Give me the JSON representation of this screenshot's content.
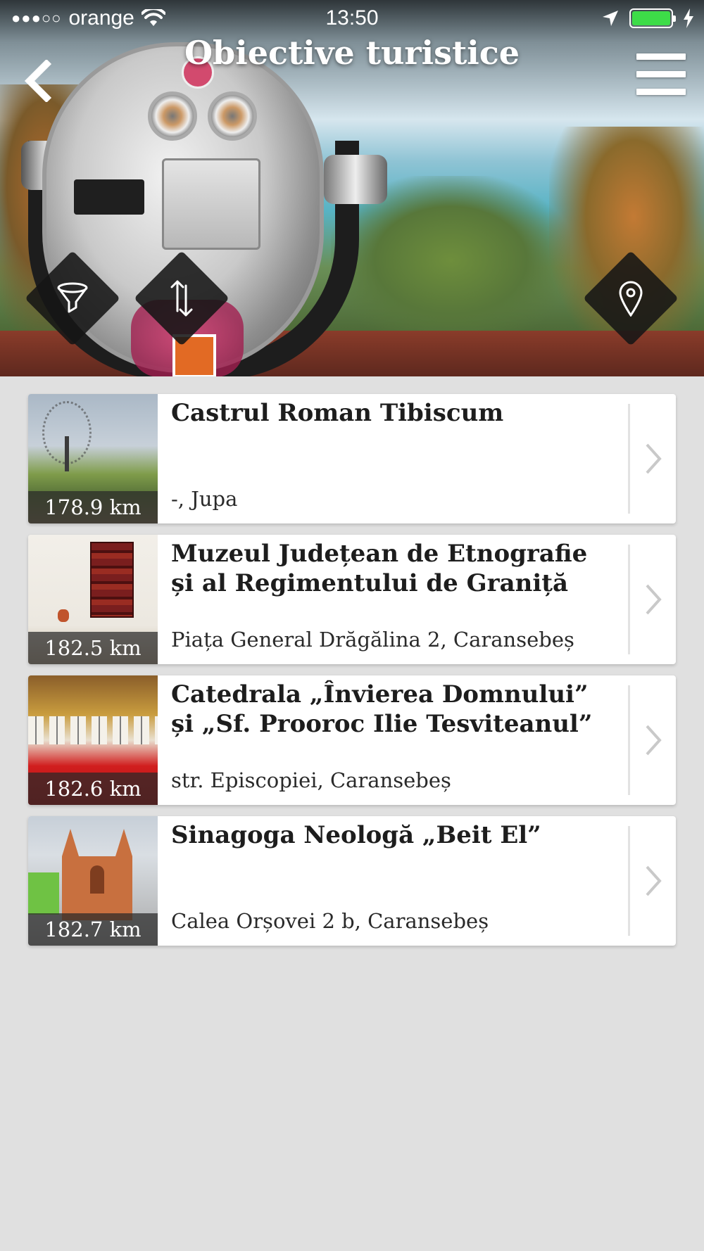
{
  "status_bar": {
    "signal": "●●●○○",
    "carrier": "orange",
    "time": "13:50"
  },
  "header": {
    "title": "Obiective turistice"
  },
  "actions": {
    "filter_icon": "funnel-icon",
    "sort_icon": "sort-arrows-icon",
    "map_icon": "map-pin-icon"
  },
  "colors": {
    "battery": "#3ddc48",
    "diamond_bg": "#161616",
    "list_bg": "#e0e0e0"
  },
  "places": [
    {
      "name": "Castrul Roman Tibiscum",
      "address": "-, Jupa",
      "distance": "178.9 km"
    },
    {
      "name": "Muzeul Județean de Etnografie și al Regimentului de Graniță",
      "address": "Piața General Drăgălina 2, Caransebeș",
      "distance": "182.5 km"
    },
    {
      "name": "Catedrala „Învierea Domnului” și „Sf. Prooroc Ilie Tesviteanul”",
      "address": "str. Episcopiei, Caransebeș",
      "distance": "182.6 km"
    },
    {
      "name": "Sinagoga Neologă „Beit El”",
      "address": "Calea Orșovei 2 b, Caransebeș",
      "distance": "182.7 km"
    }
  ]
}
